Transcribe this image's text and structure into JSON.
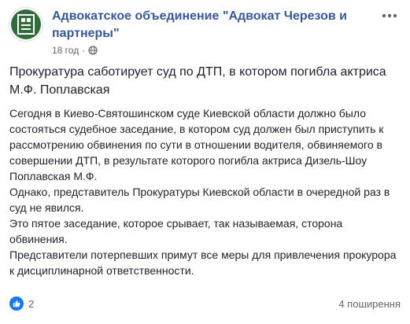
{
  "post": {
    "author": "Адвокатское объединение \"Адвокат Черезов и партнеры\"",
    "time": "18 год",
    "privacy_icon": "globe-icon",
    "more_icon": "more-horizontal-icon",
    "title": "Прокуратура саботирует суд по ДТП, в котором погибла актриса М.Ф. Поплавская",
    "paragraphs": [
      "Сегодня в Киево-Святошинском суде Киевской области должно было состояться судебное заседание, в котором суд должен был приступить к рассмотрению обвинения по сути в отношении водителя, обвиняемого в совершении ДТП, в результате которого погибла актриса Дизель-Шоу Поплавская М.Ф.",
      "Однако, представитель Прокуратуры Киевской области в очередной раз в суд не явился.",
      "Это пятое заседание, которое срывает, так называемая, сторона обвинения.",
      "Представители потерпевших примут все меры для привлечения прокурора к дисциплинарной ответственности."
    ]
  },
  "footer": {
    "reaction_icon": "like-icon",
    "reaction_count": "2",
    "shares": "4 поширення"
  },
  "colors": {
    "link": "#385898",
    "text": "#1d2129",
    "meta": "#616770",
    "like": "#1877f2",
    "avatar": "#2f6b3b"
  }
}
